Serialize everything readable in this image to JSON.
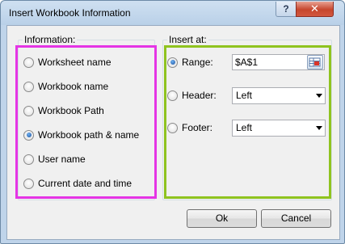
{
  "dialog": {
    "title": "Insert Workbook Information",
    "help_glyph": "?",
    "close_glyph": "✕"
  },
  "information": {
    "legend": "Information:",
    "options": [
      {
        "label": "Worksheet name",
        "checked": false
      },
      {
        "label": "Workbook name",
        "checked": false
      },
      {
        "label": "Workbook Path",
        "checked": false
      },
      {
        "label": "Workbook path & name",
        "checked": true
      },
      {
        "label": "User name",
        "checked": false
      },
      {
        "label": "Current date and time",
        "checked": false
      }
    ]
  },
  "insert_at": {
    "legend": "Insert at:",
    "range": {
      "label": "Range:",
      "checked": true,
      "value": "$A$1"
    },
    "header": {
      "label": "Header:",
      "checked": false,
      "value": "Left"
    },
    "footer": {
      "label": "Footer:",
      "checked": false,
      "value": "Left"
    }
  },
  "buttons": {
    "ok": "Ok",
    "cancel": "Cancel"
  },
  "colors": {
    "highlight_information": "#e535e5",
    "highlight_insert_at": "#8fc31f",
    "radio_selected": "#1b4f9c"
  }
}
